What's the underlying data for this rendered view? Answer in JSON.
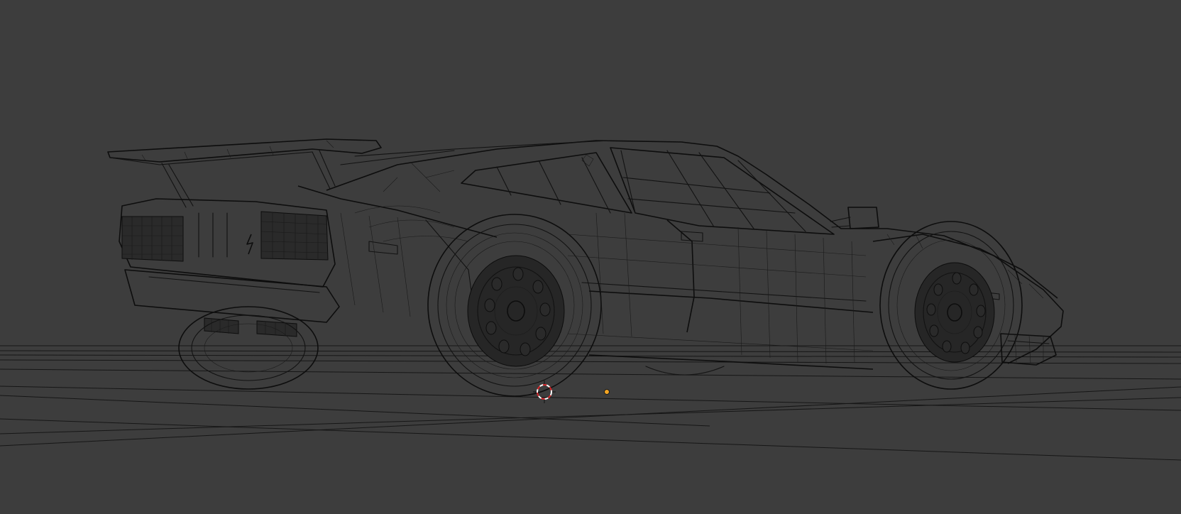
{
  "viewport": {
    "background_color": "#3d3d3d",
    "wire_color": "#121212",
    "shading_mode": "wireframe",
    "object": "sports-car-mesh"
  },
  "cursor3d": {
    "name": "3d-cursor",
    "ring_colors": [
      "#ffffff",
      "#d9262a"
    ]
  },
  "origin": {
    "name": "object-origin",
    "color": "#f5a623"
  }
}
